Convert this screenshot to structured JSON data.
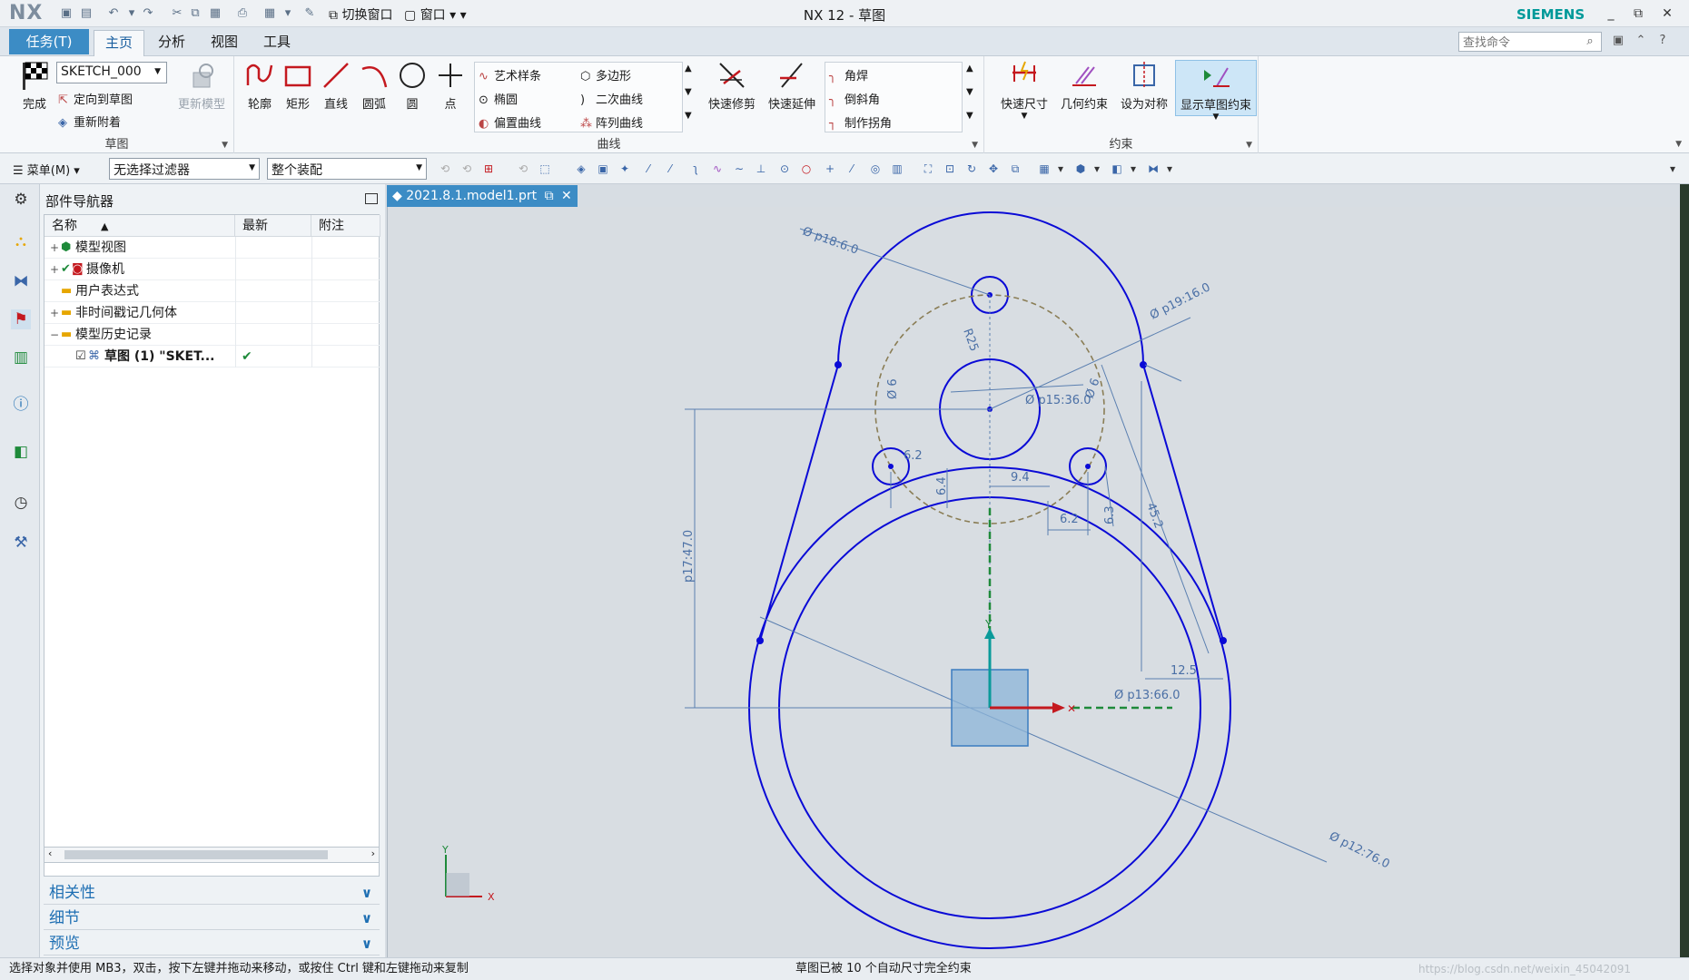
{
  "titlebar": {
    "logo": "NX",
    "switch_window": "切换窗口",
    "window_menu": "窗口",
    "title": "NX 12 - 草图",
    "brand": "SIEMENS"
  },
  "tabs": {
    "task": "任务(T)",
    "items": [
      "主页",
      "分析",
      "视图",
      "工具"
    ],
    "search_placeholder": "查找命令"
  },
  "ribbon": {
    "sketch_group": {
      "finish": "完成",
      "sketch_name": "SKETCH_000",
      "orient": "定向到草图",
      "reattach": "重新附着",
      "update_model": "更新模型",
      "label": "草图"
    },
    "curve_group": {
      "big": [
        "轮廓",
        "矩形",
        "直线",
        "圆弧",
        "圆",
        "点"
      ],
      "gallery_col1": [
        "艺术样条",
        "椭圆",
        "偏置曲线"
      ],
      "gallery_col2": [
        "多边形",
        "二次曲线",
        "阵列曲线"
      ],
      "trim": "快速修剪",
      "extend": "快速延伸",
      "gallery_col3": [
        "角焊",
        "倒斜角",
        "制作拐角"
      ],
      "label": "曲线"
    },
    "constraint_group": {
      "items": [
        "快速尺寸",
        "几何约束",
        "设为对称",
        "显示草图约束"
      ],
      "label": "约束"
    }
  },
  "toolbar2": {
    "menu": "菜单(M)",
    "filter": "无选择过滤器",
    "scope": "整个装配"
  },
  "navigator": {
    "title": "部件导航器",
    "columns": [
      "名称",
      "最新",
      "附注"
    ],
    "rows": [
      {
        "label": "模型视图",
        "expand": "+"
      },
      {
        "label": "摄像机",
        "expand": "+"
      },
      {
        "label": "用户表达式",
        "expand": ""
      },
      {
        "label": "非时间戳记几何体",
        "expand": "+"
      },
      {
        "label": "模型历史记录",
        "expand": "−"
      },
      {
        "label": "草图 (1) \"SKET...",
        "expand": "",
        "latest": "✔"
      }
    ],
    "panels": [
      "相关性",
      "细节",
      "预览"
    ]
  },
  "document": {
    "tab": "2021.8.1.model1.prt"
  },
  "sketch": {
    "dims": {
      "p18": "Ø p18:6.0",
      "p19": "Ø p19:16.0",
      "p15": "Ø p15:36.0",
      "p13": "Ø p13:66.0",
      "p12": "Ø p12:76.0",
      "p17": "p17:47.0",
      "r25": "R25",
      "d6a": "Ø 6",
      "d6b": "Ø 6",
      "v12": "12.5",
      "v45": "45.2",
      "v94": "9.4",
      "v64": "6.4",
      "v62": "6.2",
      "v63": "6.3",
      "v62b": "6.2"
    },
    "axis_y": "Y",
    "axis_x": "X"
  },
  "status": {
    "left": "选择对象并使用 MB3，双击，按下左键并拖动来移动，或按住 Ctrl 键和左键拖动来复制",
    "center": "草图已被 10 个自动尺寸完全约束",
    "watermark": "https://blog.csdn.net/weixin_45042091"
  }
}
